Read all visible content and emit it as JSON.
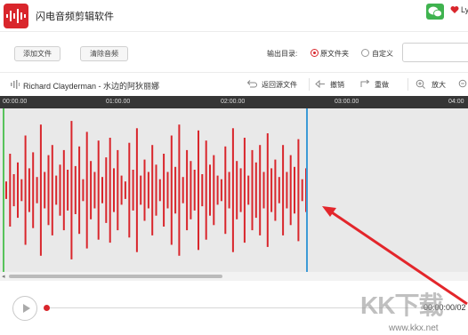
{
  "app": {
    "title": "闪电音频剪辑软件",
    "user_name": "Ly",
    "icons": {
      "logo": "waveform-logo-icon",
      "wechat": "wechat-icon",
      "user": "heart-icon"
    },
    "brand_color": "#d9262c"
  },
  "toolbar": {
    "add_file": "添加文件",
    "clear_audio": "清除音频",
    "output_label": "输出目录:",
    "output_options": [
      "原文件夹",
      "自定义"
    ],
    "output_selected": "原文件夹",
    "path_value": ""
  },
  "editor": {
    "track_title": "Richard Clayderman - 水边的阿狄丽娜",
    "return_source": "返回源文件",
    "undo": "撤销",
    "redo": "重做",
    "zoom_in": "放大"
  },
  "timeline": {
    "ticks": [
      "00:00.00",
      "01:00.00",
      "02:00.00",
      "03:00.00",
      "04:00"
    ]
  },
  "waveform": {
    "color": "#d9262c",
    "selection_start_color": "#58c35a",
    "selection_end_color": "#3c9ad6",
    "amplitudes": [
      0.12,
      0.5,
      0.22,
      0.38,
      0.15,
      0.75,
      0.3,
      0.52,
      0.18,
      0.9,
      0.25,
      0.48,
      0.62,
      0.2,
      0.35,
      0.55,
      0.28,
      0.95,
      0.33,
      0.6,
      0.15,
      0.8,
      0.4,
      0.25,
      0.68,
      0.18,
      0.45,
      0.72,
      0.3,
      0.55,
      0.2,
      0.12,
      0.65,
      0.28,
      0.85,
      0.2,
      0.42,
      0.25,
      0.62,
      0.35,
      0.15,
      0.5,
      0.25,
      0.75,
      0.32,
      0.9,
      0.18,
      0.55,
      0.4,
      0.28,
      0.82,
      0.22,
      0.68,
      0.35,
      0.48,
      0.2,
      0.15,
      0.6,
      0.25,
      0.85,
      0.4,
      0.3,
      0.72,
      0.2,
      0.55,
      0.38,
      0.62,
      0.25,
      0.78,
      0.3,
      0.42,
      0.18,
      0.62,
      0.25,
      0.48,
      0.32,
      0.7,
      0.15,
      0.3
    ]
  },
  "player": {
    "time": "00:00:00/02"
  },
  "watermark": {
    "text": "KK下载",
    "url": "www.kkx.net"
  }
}
